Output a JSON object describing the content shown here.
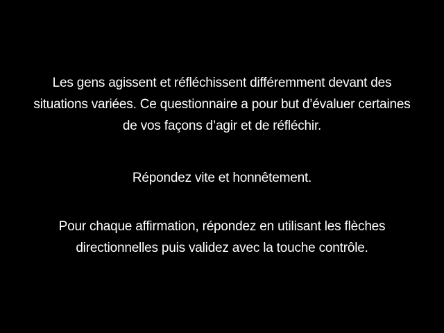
{
  "instructions": {
    "paragraph1": [
      "Les gens agissent et réfléchissent différemment devant des",
      "situations variées. Ce questionnaire a pour but d’évaluer certaines",
      "de vos façons d’agir et de réfléchir."
    ],
    "paragraph2": "Répondez vite et honnêtement.",
    "paragraph3": [
      "Pour chaque affirmation, répondez en utilisant les flèches",
      "directionnelles puis validez avec la touche contrôle."
    ]
  },
  "colors": {
    "background": "#000000",
    "text": "#ffffff"
  }
}
